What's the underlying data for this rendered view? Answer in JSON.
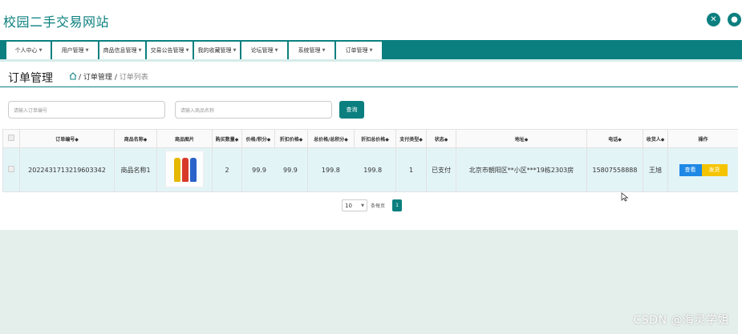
{
  "app": {
    "title": "校园二手交易网站"
  },
  "nav": {
    "items": [
      {
        "label": "个人中心"
      },
      {
        "label": "用户管理"
      },
      {
        "label": "商品信息管理"
      },
      {
        "label": "交易公告管理"
      },
      {
        "label": "我的收藏管理"
      },
      {
        "label": "论坛管理"
      },
      {
        "label": "系统管理"
      },
      {
        "label": "订单管理"
      }
    ]
  },
  "page": {
    "title": "订单管理",
    "breadcrumb": {
      "sep1": "/",
      "current": "订单管理",
      "sep2": "/",
      "last": "订单列表"
    }
  },
  "search": {
    "order_no_placeholder": "请输入订单编号",
    "product_name_placeholder": "请输入商品名称",
    "button_label": "查询"
  },
  "table": {
    "headers": [
      "订单编号◆",
      "商品名称◆",
      "商品图片",
      "购买数量◆",
      "价格/积分◆",
      "折扣价格◆",
      "总价格/总积分◆",
      "折扣总价格◆",
      "支付类型◆",
      "状态◆",
      "地址◆",
      "电话◆",
      "收货人◆",
      "操作"
    ],
    "rows": [
      {
        "order_no": "2022431713219603342",
        "product_name": "商品名称1",
        "quantity": "2",
        "price": "99.9",
        "discount_price": "99.9",
        "total": "199.8",
        "discount_total": "199.8",
        "pay_type": "1",
        "status": "已支付",
        "address": "北京市朝阳区**小区***19栋2303房",
        "phone": "15807558888",
        "receiver": "王旭",
        "view_label": "查看",
        "ship_label": "发货"
      }
    ]
  },
  "pager": {
    "page_size": "10",
    "per_page_label": "条每页",
    "current_page": "1"
  },
  "watermark": "CSDN @海灵学姐",
  "colors": {
    "accent": "#0b7f7f",
    "row_bg": "#e3f4f7",
    "view_button": "#1e88e5",
    "ship_button": "#f5c400"
  }
}
